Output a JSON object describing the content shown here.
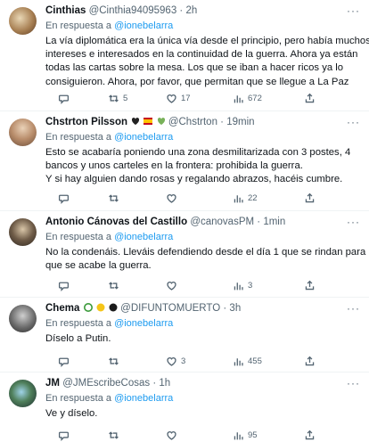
{
  "reply_prefix": "En respuesta a",
  "tweets": [
    {
      "name": "Cinthias",
      "handle": "@Cinthia94095963",
      "sep": "·",
      "time": "2h",
      "mention": "@ionebelarra",
      "lines": [
        "La vía diplomática era la única vía desde el principio, pero había muchos",
        "intereses e interesados en la continuidad de la guerra. Ahora ya están",
        "todas las cartas sobre la mesa. Los que se iban a hacer ricos ya lo",
        "consiguieron. Ahora, por favor, que permitan que se llegue a La Paz"
      ],
      "replies": "",
      "retweets": "5",
      "likes": "17",
      "views": "672"
    },
    {
      "name": "Chstrton Pilsson",
      "handle": "@Chstrton",
      "sep": "·",
      "time": "19min",
      "mention": "@ionebelarra",
      "lines": [
        "Esto se acabaría poniendo una zona desmilitarizada con 3 postes, 4",
        "bancos y unos carteles en la frontera: prohibida la guerra.",
        "Y si hay alguien dando rosas y regalando abrazos, hacéis cumbre."
      ],
      "replies": "",
      "retweets": "",
      "likes": "",
      "views": "22"
    },
    {
      "name": "Antonio Cánovas del Castillo",
      "handle": "@canovasPM",
      "sep": "·",
      "time": "1min",
      "mention": "@ionebelarra",
      "lines": [
        "No la condenáis. Lleváis defendiendo desde el día 1 que se rindan para",
        "que se acabe la guerra."
      ],
      "replies": "",
      "retweets": "",
      "likes": "",
      "views": "3"
    },
    {
      "name": "Chema",
      "handle": "@DIFUNTOMUERTO",
      "sep": "·",
      "time": "3h",
      "mention": "@ionebelarra",
      "lines": [
        "Díselo a Putin."
      ],
      "replies": "",
      "retweets": "",
      "likes": "3",
      "views": "455"
    },
    {
      "name": "JM",
      "handle": "@JMEscribeCosas",
      "sep": "·",
      "time": "1h",
      "mention": "@ionebelarra",
      "lines": [
        "Ve y díselo."
      ],
      "replies": "",
      "retweets": "",
      "likes": "",
      "views": "95"
    }
  ],
  "icons": {
    "reply": "reply-icon",
    "retweet": "retweet-icon",
    "like": "heart-icon",
    "views": "views-icon",
    "share": "share-icon",
    "more": "more-icon"
  },
  "colors": {
    "link": "#1d9bf0",
    "secondary_text": "#536471",
    "divider": "#eff3f4"
  }
}
